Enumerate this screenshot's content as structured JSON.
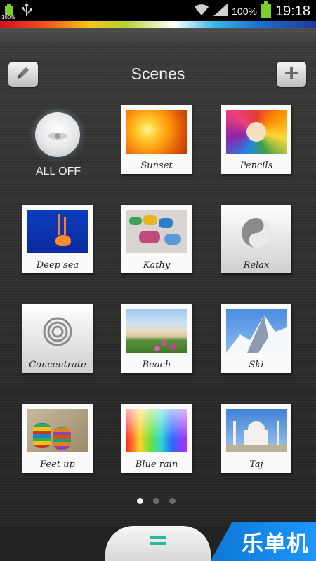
{
  "status_bar": {
    "battery_small_label": "100%",
    "battery_percent": "100%",
    "time": "19:18"
  },
  "header": {
    "title": "Scenes",
    "edit_icon": "pencil-icon",
    "add_icon": "plus-icon"
  },
  "all_off": {
    "label": "ALL OFF"
  },
  "scenes": [
    {
      "label": "Sunset"
    },
    {
      "label": "Pencils"
    },
    {
      "label": "Deep sea"
    },
    {
      "label": "Kathy"
    },
    {
      "label": "Relax"
    },
    {
      "label": "Concentrate"
    },
    {
      "label": "Beach"
    },
    {
      "label": "Ski"
    },
    {
      "label": "Feet up"
    },
    {
      "label": "Blue rain"
    },
    {
      "label": "Taj"
    }
  ],
  "pager": {
    "pages": 3,
    "current": 1
  },
  "bottom_bar": {
    "logo_text": "乐单机"
  },
  "colors": {
    "background": "#2a2a28",
    "accent_teal": "#2cb79a",
    "logo_blue": "#1b97ff"
  }
}
